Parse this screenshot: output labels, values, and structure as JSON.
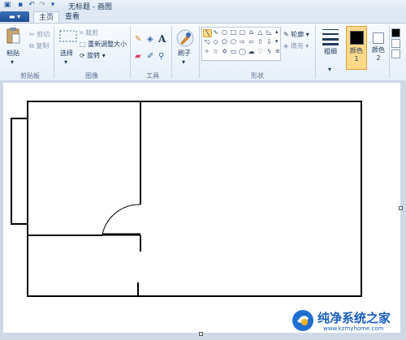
{
  "window": {
    "title": "无标题 - 画图"
  },
  "tabs": [
    {
      "label": "主页"
    },
    {
      "label": "查看"
    }
  ],
  "ribbon": {
    "clipboard": {
      "paste": "粘贴",
      "cut": "剪切",
      "copy": "复制",
      "group": "剪贴板"
    },
    "image": {
      "select": "选择",
      "crop": "裁剪",
      "resize": "重新调整大小",
      "rotate": "旋转",
      "group": "图像"
    },
    "tools": {
      "group": "工具"
    },
    "brushes": {
      "label": "刷子"
    },
    "shapes": {
      "outline": "轮廓",
      "fill": "填充",
      "group": "形状"
    },
    "size": {
      "label": "粗细"
    },
    "color1": {
      "label": "颜色 1"
    },
    "color2": {
      "label": "颜色 2"
    }
  },
  "watermark": {
    "title": "纯净系统之家",
    "url": "www.kzmyhome.com"
  },
  "colors": {
    "color1": "#000000",
    "color2": "#ffffff",
    "accent": "#1f4f96"
  }
}
